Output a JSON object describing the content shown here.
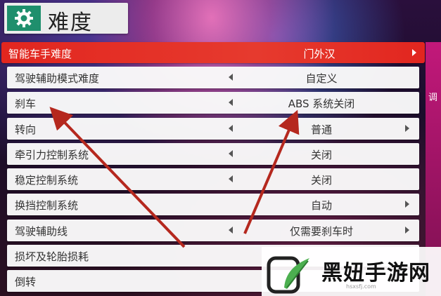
{
  "header": {
    "title": "难度",
    "icon": "gear-icon"
  },
  "side_panel": {
    "text": "调"
  },
  "settings": [
    {
      "label": "智能车手难度",
      "value": "门外汉",
      "selected": true,
      "left_arrow": false,
      "right_arrow": true
    },
    {
      "label": "驾驶辅助模式难度",
      "value": "自定义",
      "selected": false,
      "left_arrow": true,
      "right_arrow": false
    },
    {
      "label": "刹车",
      "value": "ABS 系统关闭",
      "selected": false,
      "left_arrow": true,
      "right_arrow": false
    },
    {
      "label": "转向",
      "value": "普通",
      "selected": false,
      "left_arrow": true,
      "right_arrow": true
    },
    {
      "label": "牵引力控制系统",
      "value": "关闭",
      "selected": false,
      "left_arrow": true,
      "right_arrow": false
    },
    {
      "label": "稳定控制系统",
      "value": "关闭",
      "selected": false,
      "left_arrow": true,
      "right_arrow": false
    },
    {
      "label": "换挡控制系统",
      "value": "自动",
      "selected": false,
      "left_arrow": false,
      "right_arrow": true
    },
    {
      "label": "驾驶辅助线",
      "value": "仅需要刹车时",
      "selected": false,
      "left_arrow": true,
      "right_arrow": true
    },
    {
      "label": "损坏及轮胎损耗",
      "value": "",
      "selected": false,
      "left_arrow": false,
      "right_arrow": false
    },
    {
      "label": "倒转",
      "value": "",
      "selected": false,
      "left_arrow": false,
      "right_arrow": false
    }
  ],
  "watermark": {
    "text": "黑妞手游网",
    "url": "hsxsfj.com"
  },
  "colors": {
    "selected_row": "#e2261f",
    "header_icon_bg": "#1f8f6d",
    "annotation_arrow": "#b5281e"
  }
}
